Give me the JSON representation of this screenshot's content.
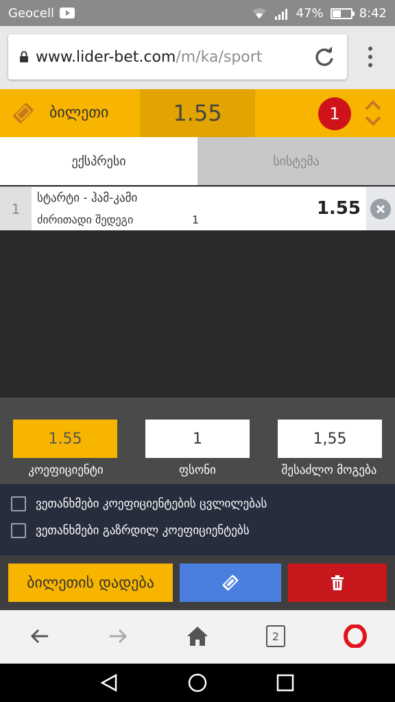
{
  "status": {
    "carrier": "Geocell",
    "battery": "47%",
    "time": "8:42",
    "battery_level": 0.47
  },
  "browser": {
    "url_host": "www.lider-bet.com",
    "url_path": "/m/ka/sport"
  },
  "ticket": {
    "title": "ბილეთი",
    "total_odds": "1.55",
    "count": "1"
  },
  "tabs": [
    {
      "label": "ექსპრესი",
      "active": true
    },
    {
      "label": "სისტემა",
      "active": false
    }
  ],
  "bet": {
    "index": "1",
    "match": "სტარტი - ჰამ-კამი",
    "market": "ძირითადი შედეგი",
    "outcome": "1",
    "odds": "1.55"
  },
  "stakes": {
    "odds_value": "1.55",
    "odds_label": "კოეფიციენტი",
    "stake_value": "1",
    "stake_label": "ფსონი",
    "win_value": "1,55",
    "win_label": "შესაძლო მოგება"
  },
  "agreements": [
    {
      "label": "ვეთანხმები კოეფიციენტების ცვლილებას",
      "checked": false
    },
    {
      "label": "ვეთანხმები გაზრდილ კოეფიციენტებს",
      "checked": false
    }
  ],
  "actions": {
    "place_label": "ბილეთის დადება"
  },
  "browser_nav": {
    "tab_count": "2"
  },
  "colors": {
    "accent": "#f7b500",
    "accent_dark": "#e1a400",
    "danger": "#c8161d",
    "primary": "#4a7fe0",
    "opera": "#e0141e"
  }
}
